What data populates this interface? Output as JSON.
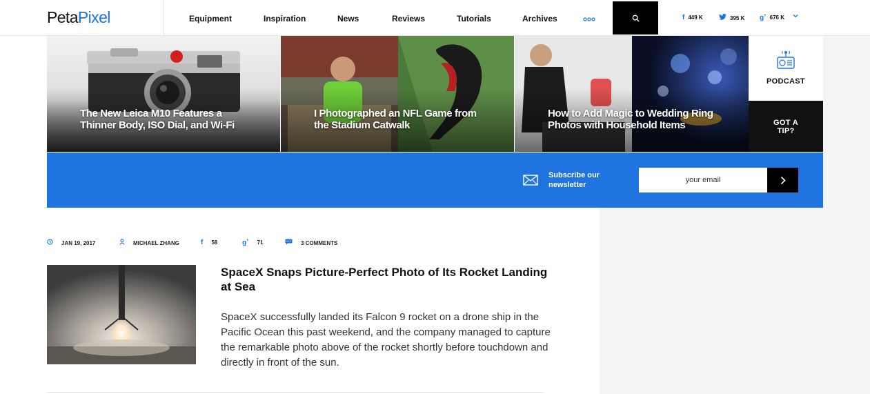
{
  "brand": {
    "part1": "Peta",
    "part2": "Pixel"
  },
  "nav": [
    "Equipment",
    "Inspiration",
    "News",
    "Reviews",
    "Tutorials",
    "Archives"
  ],
  "social": {
    "facebook": "449 K",
    "twitter": "395 K",
    "googleplus": "676 K"
  },
  "hero": [
    {
      "title": "The New Leica M10 Features a Thinner Body, ISO Dial, and Wi-Fi"
    },
    {
      "title": "I Photographed an NFL Game from the Stadium Catwalk"
    },
    {
      "title": "How to Add Magic to Wedding Ring Photos with Household Items"
    }
  ],
  "side": {
    "podcast": "PODCAST",
    "tip": "GOT A TIP?"
  },
  "newsletter": {
    "text": "Subscribe our newsletter",
    "placeholder": "your email"
  },
  "article": {
    "date": "JAN 19, 2017",
    "author": "MICHAEL ZHANG",
    "facebook_count": "58",
    "gplus_count": "71",
    "comments": "3 COMMENTS",
    "title": "SpaceX Snaps Picture-Perfect Photo of Its Rocket Landing at Sea",
    "excerpt": "SpaceX successfully landed its Falcon 9 rocket on a drone ship in the Pacific Ocean this past weekend, and the company managed to capture the remarkable photo above of the rocket shortly before touchdown and directly in front of the sun."
  },
  "colors": {
    "accent": "#1a73e8",
    "newsletter_bg": "#1f74e0",
    "dark": "#111111"
  }
}
